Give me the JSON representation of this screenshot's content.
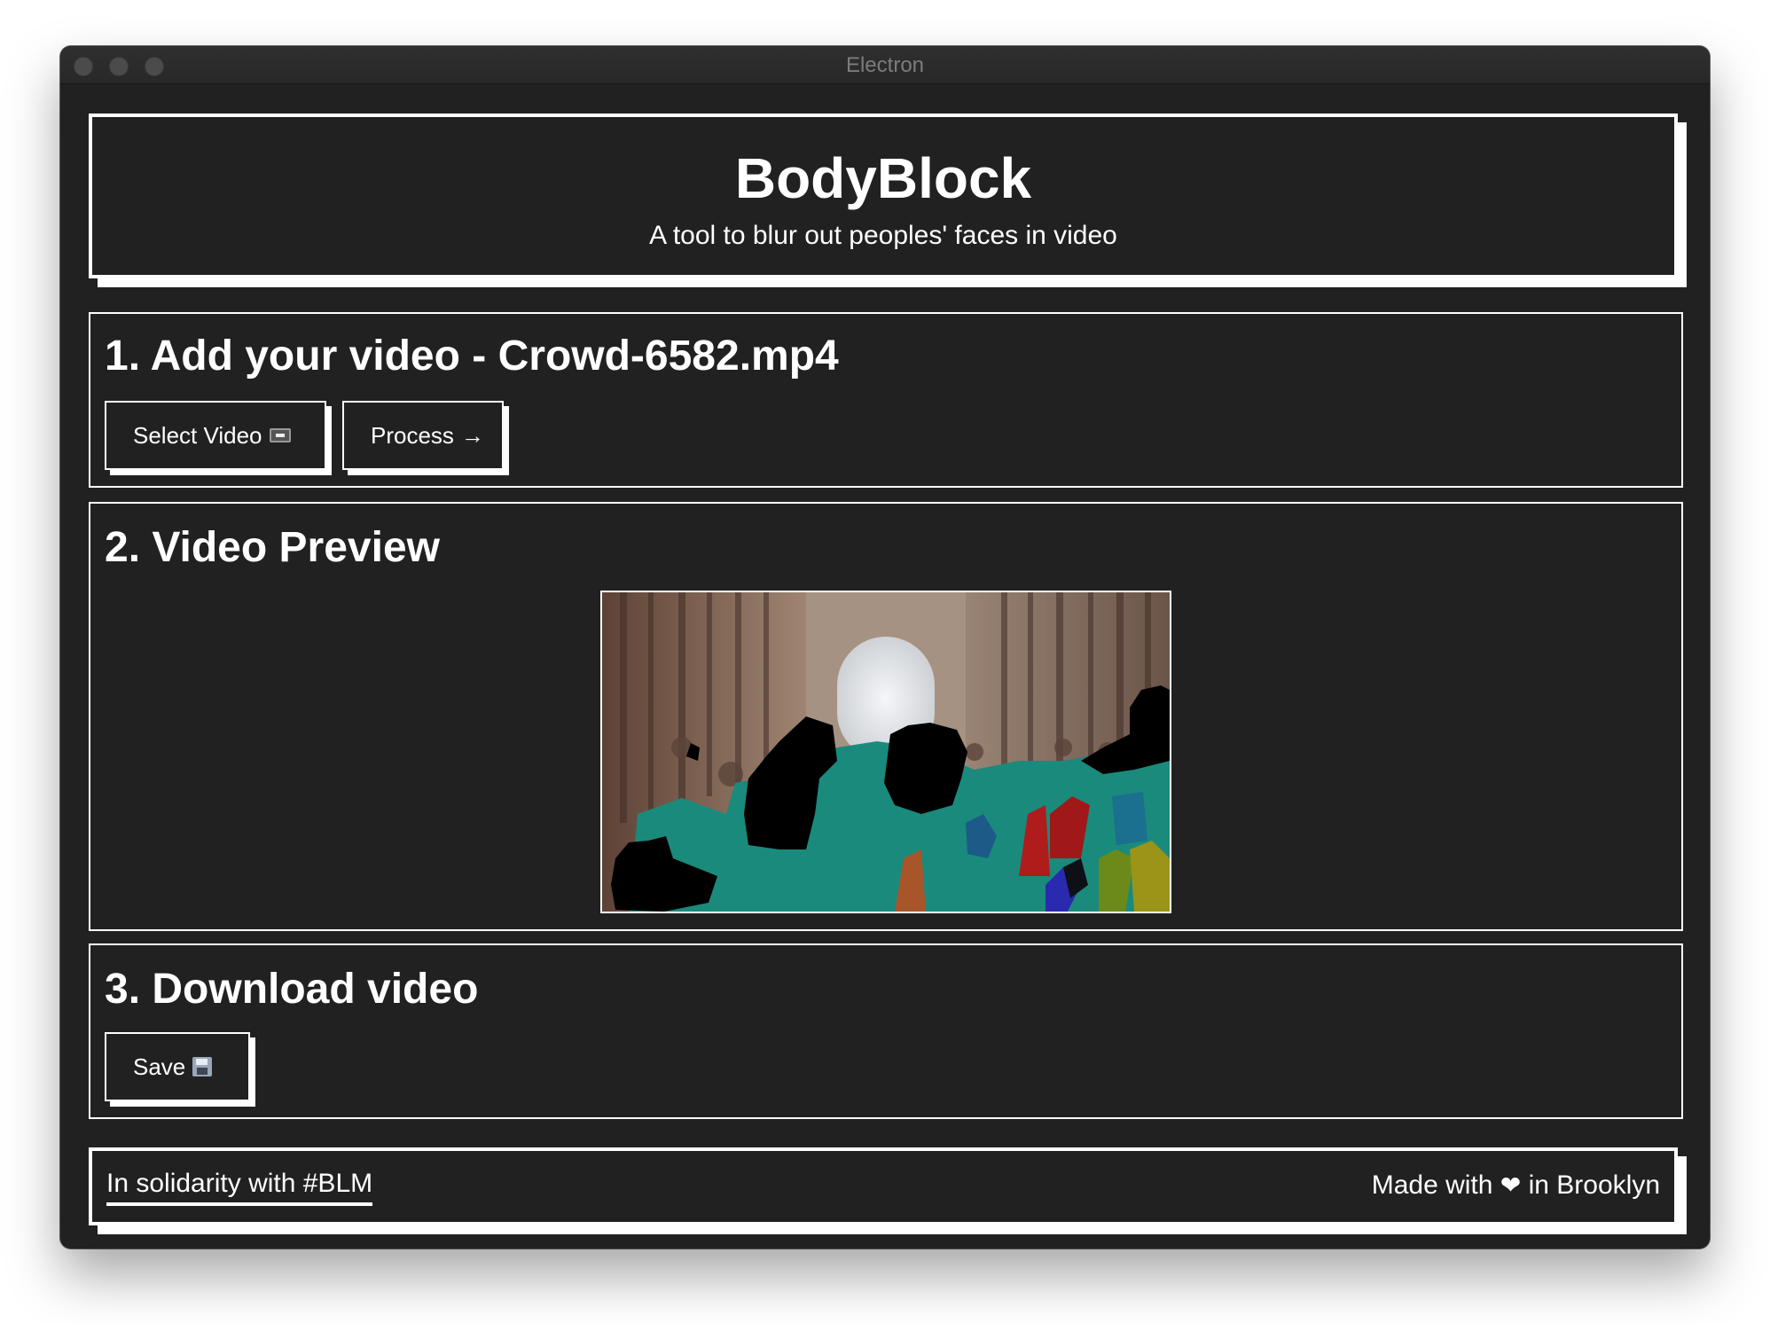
{
  "window": {
    "title": "Electron"
  },
  "header": {
    "title": "BodyBlock",
    "subtitle": "A tool to blur out peoples' faces in video"
  },
  "step1": {
    "heading": "1. Add your video - Crowd-6582.mp4",
    "select_label": "Select Video",
    "select_icon": "cassette-icon",
    "process_label": "Process",
    "process_icon": "arrow-right-icon"
  },
  "step2": {
    "heading": "2. Video Preview"
  },
  "step3": {
    "heading": "3. Download video",
    "save_label": "Save",
    "save_icon": "floppy-disk-icon"
  },
  "footer": {
    "left_text": "In solidarity with #BLM",
    "right_prefix": "Made with",
    "right_heart": "❤",
    "right_suffix": "in Brooklyn"
  },
  "colors": {
    "background": "#212121",
    "foreground": "#ffffff",
    "mask_teal": "#1a8a7c",
    "mask_black": "#000000"
  }
}
